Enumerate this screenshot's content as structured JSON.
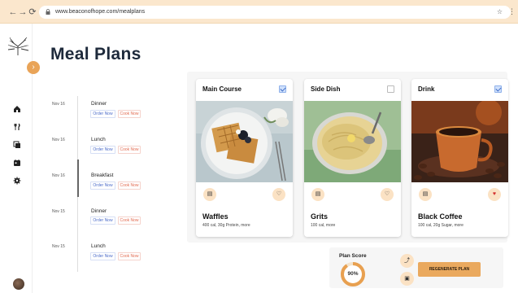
{
  "browser": {
    "url": "www.beaconofhope.com/mealplans",
    "back": "←",
    "forward": "→",
    "reload": "⟳",
    "bookmark": "☆",
    "menu": "⋮"
  },
  "sidebar": {
    "expand_glyph": "›",
    "items": [
      {
        "icon": "home-icon"
      },
      {
        "icon": "utensils-icon"
      },
      {
        "icon": "meal-plans-icon"
      },
      {
        "icon": "calendar-icon"
      },
      {
        "icon": "settings-icon"
      }
    ]
  },
  "page": {
    "title": "Meal Plans"
  },
  "timeline": [
    {
      "date": "Nov 16",
      "meal": "Dinner",
      "order": "Order Now",
      "cook": "Cook Now"
    },
    {
      "date": "Nov 16",
      "meal": "Lunch",
      "order": "Order Now",
      "cook": "Cook Now"
    },
    {
      "date": "Nov 16",
      "meal": "Breakfast",
      "order": "Order Now",
      "cook": "Cook Now",
      "active": true
    },
    {
      "date": "Nov 15",
      "meal": "Dinner",
      "order": "Order Now",
      "cook": "Cook Now"
    },
    {
      "date": "Nov 15",
      "meal": "Lunch",
      "order": "Order Now",
      "cook": "Cook Now"
    }
  ],
  "cards": [
    {
      "heading": "Main Course",
      "checked": true,
      "name": "Waffles",
      "info": "400 cal, 30g Protein, more",
      "favorite": false
    },
    {
      "heading": "Side Dish",
      "checked": false,
      "name": "Grits",
      "info": "100 cal, more",
      "favorite": false
    },
    {
      "heading": "Drink",
      "checked": true,
      "name": "Black Coffee",
      "info": "100 cal, 20g Sugar, more",
      "favorite": true
    }
  ],
  "plan": {
    "score_label": "Plan Score",
    "score_text": "90%",
    "score_value": 0.9,
    "regenerate_label": "REGENERATE PLAN"
  },
  "colors": {
    "accent": "#eaa95e",
    "title": "#1e2a3b",
    "order": "#4a6bc9",
    "cook": "#e26a4f"
  }
}
